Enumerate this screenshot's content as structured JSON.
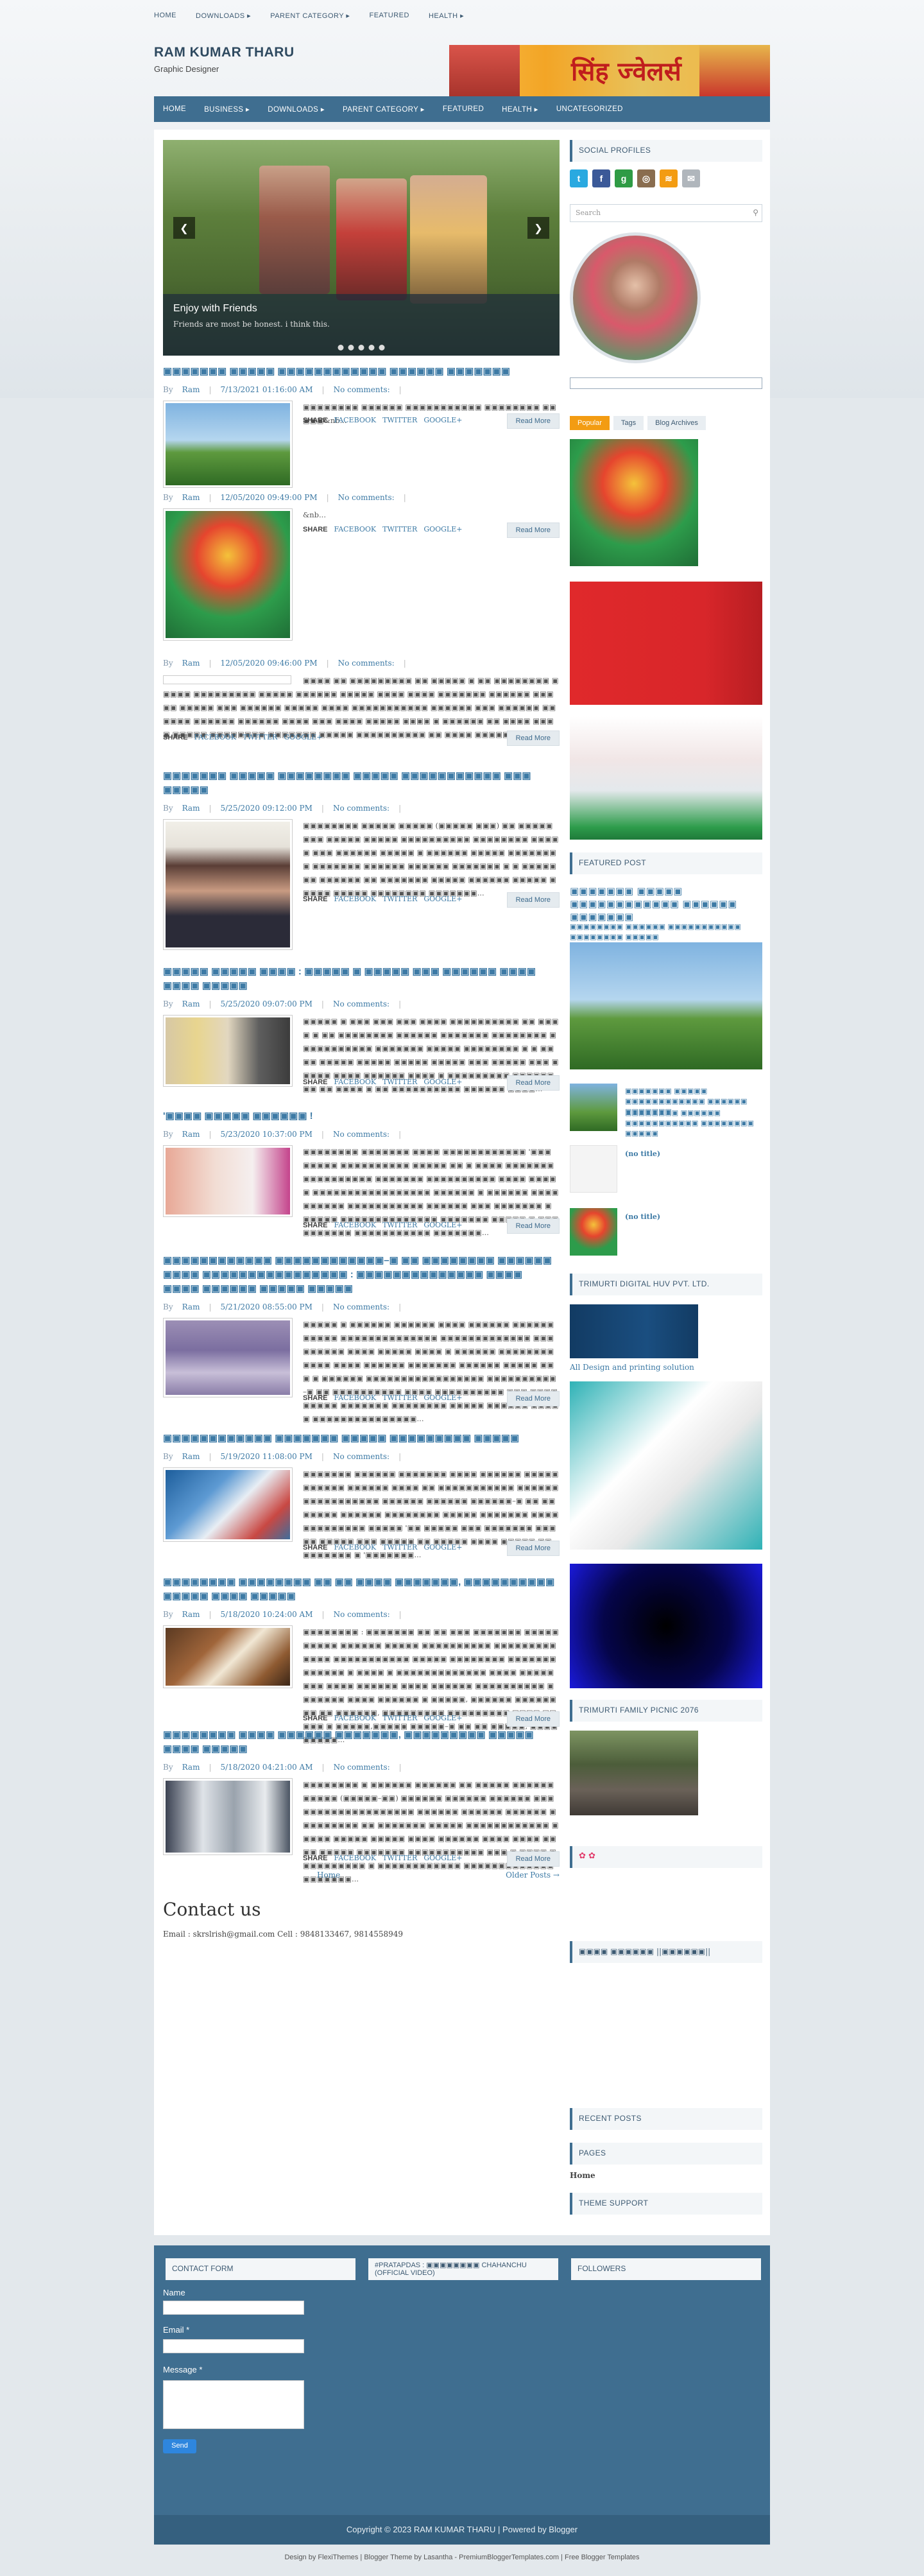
{
  "topnav": {
    "items": [
      "HOME",
      "DOWNLOADS ▸",
      "PARENT CATEGORY ▸",
      "FEATURED",
      "HEALTH ▸"
    ]
  },
  "brand": {
    "title": "RAM KUMAR THARU",
    "subtitle": "Graphic Designer",
    "banner_text": "सिंह ज्वेलर्स"
  },
  "mainnav": {
    "items": [
      "HOME",
      "BUSINESS ▸",
      "DOWNLOADS ▸",
      "PARENT CATEGORY ▸",
      "FEATURED",
      "HEALTH ▸",
      "UNCATEGORIZED"
    ]
  },
  "slider": {
    "caption_title": "Enjoy with Friends",
    "caption_text": "Friends are most be honest. i think this.",
    "prev": "❮",
    "next": "❯"
  },
  "share": {
    "label": "SHARE",
    "facebook": "FACEBOOK",
    "twitter": "TWITTER",
    "google": "GOOGLE+"
  },
  "read_more": "Read More",
  "meta": {
    "by": "By",
    "author": "Ram",
    "comments": "No comments:"
  },
  "posts": [
    {
      "title": "▣▣▣▣▣▣▣ ▣▣▣▣▣ ▣▣▣▣▣▣▣▣▣▣▣▣ ▣▣▣▣▣▣ ▣▣▣▣▣▣▣",
      "date": "7/13/2021 01:16:00 AM",
      "snippet": "▣▣▣▣▣▣▣▣ ▣▣▣▣▣▣ ▣▣▣▣▣▣▣▣▣▣▣ ▣▣▣▣▣▣▣▣ ▣▣▣▣▣&nb..."
    },
    {
      "title": "",
      "date": "12/05/2020 09:49:00 PM",
      "snippet": "&nb..."
    },
    {
      "title": "",
      "date": "12/05/2020 09:46:00 PM",
      "snippet": "▣▣▣▣ ▣▣ ▣▣▣▣▣▣▣▣▣ ▣▣ ▣▣▣▣▣ ▣ ▣▣ ▣▣▣▣▣▣▣▣ ▣▣▣▣▣ ▣▣▣▣▣▣▣▣▣ ▣▣▣▣▣ ▣▣▣▣▣▣ ▣▣▣▣▣ ▣▣▣▣ ▣▣▣▣ ▣▣▣▣▣▣▣ ▣▣▣▣▣▣ ▣▣▣▣▣ ▣▣▣▣▣ ▣▣▣ ▣▣▣▣▣▣ ▣▣▣▣▣ ▣▣▣▣ ▣▣▣▣▣▣▣▣▣▣▣ ▣▣▣▣▣▣ ▣▣▣ ▣▣▣▣▣▣ ▣▣▣▣▣▣ ▣▣▣▣▣▣ ▣▣▣▣▣▣ ▣▣▣▣ ▣▣▣ ▣▣▣▣ ▣▣▣▣▣ ▣▣▣▣ ▣ ▣▣▣▣▣▣ ▣▣ ▣▣▣▣ ▣▣▣▣ ▣▣▣▣▣ ▣▣▣▣▣▣▣▣ ▣▣▣▣▣▣▣ ▣▣▣▣▣ ▣▣▣▣▣▣▣▣▣▣ ▣▣ ▣▣▣▣ ▣▣▣▣▣ ▣▣..."
    },
    {
      "title": "▣▣▣▣▣▣▣ ▣▣▣▣▣ ▣▣▣▣▣▣▣▣ ▣▣▣▣▣ ▣▣▣▣▣▣▣▣▣▣▣ ▣▣▣ ▣▣▣▣▣",
      "date": "5/25/2020 09:12:00 PM",
      "snippet": "▣▣▣▣▣▣▣▣ ▣▣▣▣▣ ▣▣▣▣▣ (▣▣▣▣▣ ▣▣▣) ▣▣ ▣▣▣▣▣▣▣▣ ▣▣▣▣▣ ▣▣▣▣▣ ▣▣▣▣▣▣▣▣▣▣ ▣▣▣▣▣▣▣▣ ▣▣▣▣▣ ▣▣▣ ▣▣▣▣▣▣ ▣▣▣▣▣ ▣ ▣▣▣▣▣▣ ▣▣▣▣▣ ▣▣▣▣▣▣▣▣ ▣▣▣▣▣▣▣ ▣▣▣▣▣▣ ▣▣▣▣▣▣ ▣▣▣▣▣▣▣ ▣ ▣ ▣▣▣▣▣▣▣ ▣▣▣▣▣▣ ▣▣ ▣▣▣▣▣▣▣ ▣▣▣▣▣ ▣▣▣▣▣▣ ▣▣▣▣▣ ▣▣▣▣▣ ▣▣▣▣▣ ▣▣▣▣▣▣▣▣ ▣▣▣▣▣▣▣..."
    },
    {
      "title": "▣▣▣▣▣ ▣▣▣▣▣ ▣▣▣▣ : ▣▣▣▣▣ ▣ ▣▣▣▣▣ ▣▣▣ ▣▣▣▣▣▣ ▣▣▣▣ ▣▣▣▣ ▣▣▣▣▣",
      "date": "5/25/2020 09:07:00 PM",
      "snippet": "▣▣▣▣▣ ▣ ▣▣▣ ▣▣▣ ▣▣▣ ▣▣▣▣ ▣▣▣▣▣▣▣▣▣▣ ▣▣ ▣▣▣▣ ▣ ▣▣ ▣▣▣▣▣▣▣▣ ▣▣▣▣▣▣ ▣▣▣▣▣▣▣ ▣▣▣▣▣▣▣▣ ▣▣▣▣▣▣▣▣▣▣▣ ▣▣▣▣▣▣▣ ▣▣▣▣▣ ▣▣▣▣▣▣▣▣ ▣ ▣ ▣▣▣▣ ▣▣▣▣▣ ▣▣▣▣▣ ▣▣▣▣▣ ▣▣▣▣▣ ▣▣▣ ▣▣▣▣▣ ▣▣▣ ▣▣▣▣▣ ▣▣▣▣ ▣▣▣▣▣▣ ▣▣▣▣ ▣ ▣▣▣▣▣▣▣▣▣ ▣▣▣▣▣▣▣▣ ▣▣ ▣▣▣▣ ▣ ▣▣ ▣▣▣▣▣▣▣▣▣▣ ▣▣▣▣▣▣ ▣▣▣▣..."
    },
    {
      "title": "'▣▣▣▣ ▣▣▣▣▣ ▣▣▣▣▣▣ !",
      "date": "5/23/2020 10:37:00 PM",
      "snippet": "▣▣▣▣▣▣▣▣ ▣▣▣▣▣▣▣ ▣▣▣▣ ▣▣▣▣▣▣▣▣▣▣▣▣ '▣▣▣ ▣▣▣▣▣ ▣▣▣▣▣▣▣▣▣▣ ▣▣▣▣▣ ▣▣ ▣ ▣▣▣▣ ▣▣▣▣▣▣▣ ▣▣▣▣▣▣▣▣▣▣ ▣▣▣▣▣▣▣ ▣▣▣▣▣▣▣▣▣▣ ▣▣▣▣ ▣▣▣▣▣ ▣▣▣▣▣▣▣▣▣▣▣▣▣▣▣▣▣ ▣▣▣▣▣▣ ▣ ▣▣▣▣▣▣ ▣▣▣▣▣▣▣▣▣▣ ▣▣▣▣▣▣▣▣▣▣▣ ▣▣▣▣▣▣ ▣▣▣ ▣▣▣▣▣▣▣ ▣ ▣▣▣▣▣ ▣▣▣▣▣▣▣▣▣▣▣▣▣▣ ▣▣▣▣▣▣▣ ▣▣▣▣▣ ▣ ▣▣▣▣▣▣▣▣▣▣ ▣▣▣▣▣▣▣▣▣▣▣ ▣▣▣▣▣▣▣..."
    },
    {
      "title": "▣▣▣▣▣▣▣▣▣▣▣▣ ▣▣▣▣▣▣▣▣▣▣▣▣–▣ ▣▣ ▣▣▣▣▣▣▣▣ ▣▣▣▣▣▣ ▣▣▣▣ ▣▣▣▣▣▣▣▣▣▣▣▣▣▣▣▣ : ▣▣▣▣▣▣▣▣▣▣▣▣▣▣ ▣▣▣▣ ▣▣▣▣ ▣▣▣▣▣▣ ▣▣▣▣▣ ▣▣▣▣▣",
      "date": "5/21/2020 08:55:00 PM",
      "snippet": "▣▣▣▣▣ ▣ ▣▣▣▣▣▣ ▣▣▣▣▣▣ ▣▣▣▣ ▣▣▣▣▣▣ ▣▣▣▣▣▣▣▣▣▣▣ ▣▣▣▣▣▣▣▣▣▣▣▣▣▣ ▣▣▣▣▣▣▣▣▣▣▣▣▣ ▣▣▣▣▣▣▣▣▣ ▣▣▣▣ ▣▣▣▣▣ ▣▣▣▣ ▣ ▣▣▣▣▣▣ ▣▣▣▣▣▣▣▣▣▣▣▣ ▣▣▣▣ ▣▣▣▣▣▣ ▣▣▣▣▣▣▣ ▣▣▣▣▣▣ ▣▣▣▣▣ ▣▣▣ ▣ ▣▣▣▣▣▣ ▣▣▣▣▣▣▣▣▣▣▣▣▣▣▣▣▣ ▣▣▣▣▣▣▣▣▣▣–▣ ▣▣ ▣▣▣▣▣▣▣▣▣▣ ▣▣▣▣ ▣▣▣▣▣▣▣▣▣▣ ▣▣▣ ▣▣▣▣ ▣▣▣▣▣ ▣▣▣▣▣▣▣ ▣▣▣▣▣▣▣▣ ▣▣▣▣▣ ▣▣▣▣▣▣ ▣▣▣▣▣ ▣▣▣▣▣▣▣▣▣▣▣▣▣▣▣..."
    },
    {
      "title": "▣▣▣▣▣▣▣▣▣▣▣▣ ▣▣▣▣▣▣▣ ▣▣▣▣▣ ▣▣▣▣▣▣▣▣▣ ▣▣▣▣▣",
      "date": "5/19/2020 11:08:00 PM",
      "snippet": "▣▣▣▣▣▣▣ ▣▣▣▣▣▣ ▣▣▣▣▣▣▣ ▣▣▣▣ ▣▣▣▣▣▣ ▣▣▣▣▣▣▣▣▣▣▣ ▣▣▣▣▣▣ ▣▣▣▣ ▣▣ ▣▣▣▣▣▣▣▣▣▣▣ ▣▣▣▣▣▣ ▣▣▣▣▣▣▣▣▣▣▣ ▣▣▣▣▣▣ ▣▣▣▣▣▣ ▣▣▣▣▣▣–▣ ▣▣ ▣▣▣▣▣▣▣ ▣▣▣▣▣▣ ▣▣▣▣▣▣▣▣ ▣▣▣▣▣ ▣▣▣▣▣▣▣ ▣▣▣▣▣▣▣▣▣▣▣▣▣ ▣▣▣▣▣ '▣▣ ▣▣▣▣▣ ▣▣▣ ▣▣▣▣▣▣▣ ▣▣▣▣▣ ▣▣▣▣▣ ▣▣▣ ▣▣▣▣▣ ▣▣ ▣▣▣▣▣ ▣▣▣▣ ▣▣▣▣▣ ▣▣ ▣▣▣▣▣▣▣ ▣ '▣▣▣▣▣▣▣..."
    },
    {
      "title": "▣▣▣▣▣▣▣▣ ▣▣▣▣▣▣▣▣ ▣▣ ▣▣ ▣▣▣▣ ▣▣▣▣▣▣▣, ▣▣▣▣▣▣▣▣▣▣ ▣▣▣▣▣ ▣▣▣▣ ▣▣▣▣▣",
      "date": "5/18/2020 10:24:00 AM",
      "snippet": "▣▣▣▣▣▣▣▣ : ▣▣▣▣▣▣▣ ▣▣ ▣▣ ▣▣▣ ▣▣▣▣▣▣▣ ▣▣▣▣▣▣▣▣▣▣ ▣▣▣▣▣▣ ▣▣▣▣▣ ▣▣▣▣▣▣▣▣▣▣ ▣▣▣▣▣▣▣▣▣▣▣▣▣ ▣▣▣▣▣▣▣▣▣▣▣ ▣▣▣▣▣ ▣▣▣▣▣▣▣▣ ▣▣▣▣▣▣▣ ▣▣▣▣▣▣ ▣ ▣▣▣▣ ▣ ▣▣▣▣▣▣▣▣▣▣▣▣▣ ▣▣▣▣ ▣▣▣▣▣▣▣▣ ▣▣▣▣ ▣▣▣▣▣▣ ▣▣▣▣ ▣▣▣▣▣▣ ▣▣▣▣▣▣▣▣▣▣ ▣▣▣▣▣▣▣ ▣▣▣▣ ▣▣▣▣▣▣ ▣ ▣▣▣▣▣, ▣▣▣▣▣▣ ▣▣▣▣▣▣▣▣ ▣▣ ▣▣▣▣▣▣, ▣▣▣▣▣▣▣▣▣ ▣▣▣▣▣▣▣▣▣ ▣▣▣▣ ▣▣▣▣▣ ▣ ▣▣▣▣▣,▣▣▣▣▣ ▣▣▣▣▣–▣ ▣▣ ▣▣ ▣▣▣▣▣, ▣▣▣▣▣▣▣▣▣..."
    },
    {
      "title": "▣▣▣▣▣▣▣▣ ▣▣▣▣ ▣▣▣▣▣▣ ▣▣▣▣▣▣▣, ▣▣▣▣▣▣▣▣▣ ▣▣▣▣▣ ▣▣▣▣ ▣▣▣▣▣",
      "date": "5/18/2020 04:21:00 AM",
      "snippet": "▣▣▣▣▣▣▣▣ ▣ ▣▣▣▣▣▣ ▣▣▣▣▣▣ ▣▣ ▣▣▣▣▣ ▣▣▣▣▣▣ ▣▣▣▣▣ (▣▣▣▣▣–▣▣) ▣▣▣▣▣▣ ▣▣▣▣▣▣ ▣▣▣▣▣▣ ▣▣▣ ▣▣▣▣▣▣▣▣▣▣▣▣▣▣▣▣ ▣▣▣▣▣▣ ▣▣▣▣▣▣ ▣▣▣▣▣▣ ▣ ▣▣▣▣▣▣▣▣ ▣▣ ▣▣▣▣▣▣▣ ▣▣▣▣▣ ▣▣▣▣▣▣▣▣▣▣▣▣ ▣▣▣▣▣ ▣▣▣▣▣ ▣▣▣▣▣ ▣▣▣▣ ▣▣▣▣▣▣ ▣▣▣▣ ▣▣▣▣ ▣▣▣▣ ▣▣▣▣▣ ▣▣▣▣▣▣▣ ▣▣▣▣▣▣▣▣▣▣▣ ▣▣▣ ▣ ▣▣▣▣ ▣▣▣▣▣▣▣▣▣▣ ▣ ▣▣▣▣▣▣▣▣▣▣▣▣ ▣▣▣▣▣▣▣▣▣▣▣▣▣ ▣▣▣▣▣▣▣..."
    }
  ],
  "pager": {
    "home": "Home",
    "older": "Older Posts →"
  },
  "contact": {
    "heading": "Contact us",
    "text": "Email : skrslrish@gmail.com Cell : 9848133467, 9814558949"
  },
  "sidebar": {
    "social_title": "SOCIAL PROFILES",
    "search_placeholder": "Search",
    "tabs": [
      "Popular",
      "Tags",
      "Blog Archives"
    ],
    "featured_title": "FEATURED POST",
    "featured_post_title": "▣▣▣▣▣▣▣ ▣▣▣▣▣ ▣▣▣▣▣▣▣▣▣▣▣▣ ▣▣▣▣▣▣ ▣▣▣▣▣▣▣",
    "featured_snippet": "▣▣▣▣▣▣▣▣ ▣▣▣▣▣▣ ▣▣▣▣▣▣▣▣▣▣▣ ▣▣▣▣▣▣▣▣ ▣▣▣▣▣",
    "list1_title": "▣▣▣▣▣▣▣ ▣▣▣▣▣ ▣▣▣▣▣▣▣▣▣▣▣▣ ▣▣▣▣▣▣ ▣▣▣▣▣▣▣",
    "list1_snippet": "▣▣▣▣▣▣▣▣ ▣▣▣▣▣▣ ▣▣▣▣▣▣▣▣▣▣▣ ▣▣▣▣▣▣▣▣ ▣▣▣▣▣",
    "no_title": "(no title)",
    "trimurti_title": "TRIMURTI DIGITAL HUV PVT. LTD.",
    "trimurti_caption": "All Design and printing solution",
    "picnic_title": "TRIMURTI FAMILY PICNIC 2076",
    "text_widget_title": "▣▣▣▣ ▣▣▣▣▣▣ ||▣▣▣▣▣▣||",
    "recent_title": "RECENT POSTS",
    "pages_title": "PAGES",
    "pages_home": "Home",
    "support_title": "THEME SUPPORT"
  },
  "footer": {
    "contact_title": "CONTACT FORM",
    "video_title": "#PRATAPDAS : ▣▣▣▣▣▣▣▣ CHAHANCHU (OFFICIAL VIDEO)",
    "followers_title": "FOLLOWERS",
    "name_label": "Name",
    "email_label": "Email *",
    "message_label": "Message *",
    "send": "Send",
    "copyright": "Copyright © 2023 RAM KUMAR THARU | Powered by Blogger",
    "credit": "Design by FlexiThemes | Blogger Theme by Lasantha - PremiumBloggerTemplates.com | Free Blogger Templates"
  }
}
